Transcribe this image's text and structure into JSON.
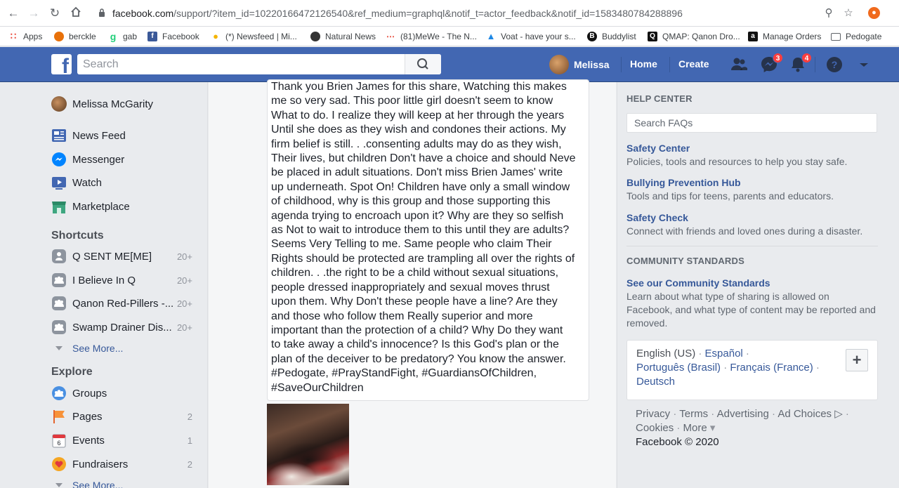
{
  "browser": {
    "url_host": "facebook.com",
    "url_rest": "/support/?item_id=10220166472126540&ref_medium=graphql&notif_t=actor_feedback&notif_id=1583480784288896",
    "bookmarks": [
      {
        "label": "Apps",
        "icon": "apps-grid-icon",
        "color": "#ea4335"
      },
      {
        "label": "berckle",
        "icon": "berckle-icon",
        "color": "#e8710a"
      },
      {
        "label": "gab",
        "icon": "gab-icon",
        "color": "#21cf7a"
      },
      {
        "label": "Facebook",
        "icon": "facebook-icon",
        "color": "#3b5998"
      },
      {
        "label": "(*) Newsfeed | Mi...",
        "icon": "lightbulb-icon",
        "color": "#f4b400"
      },
      {
        "label": "Natural News",
        "icon": "natural-news-icon",
        "color": "#333333"
      },
      {
        "label": "(81)MeWe - The N...",
        "icon": "mewe-icon",
        "color": "#e74c3c"
      },
      {
        "label": "Voat - have your s...",
        "icon": "voat-icon",
        "color": "#1e88e5"
      },
      {
        "label": "Buddylist",
        "icon": "buddylist-icon",
        "color": "#111111"
      },
      {
        "label": "QMAP: Qanon Dro...",
        "icon": "qmap-icon",
        "color": "#111111"
      },
      {
        "label": "Manage Orders",
        "icon": "amazon-icon",
        "color": "#111111"
      },
      {
        "label": "Pedogate",
        "icon": "folder-icon",
        "color": "#5f6368"
      }
    ]
  },
  "topbar": {
    "search_placeholder": "Search",
    "user_name": "Melissa",
    "home": "Home",
    "create": "Create",
    "messages_badge": "3",
    "notifications_badge": "4"
  },
  "sidebar": {
    "profile_name": "Melissa McGarity",
    "main_items": [
      {
        "label": "News Feed",
        "icon": "news-feed-icon"
      },
      {
        "label": "Messenger",
        "icon": "messenger-icon"
      },
      {
        "label": "Watch",
        "icon": "watch-icon"
      },
      {
        "label": "Marketplace",
        "icon": "marketplace-icon"
      }
    ],
    "shortcuts_title": "Shortcuts",
    "shortcuts": [
      {
        "label": "Q SENT ME[ME]",
        "count": "20+"
      },
      {
        "label": "I Believe In Q",
        "count": "20+"
      },
      {
        "label": "Qanon Red-Pillers -...",
        "count": "20+"
      },
      {
        "label": "Swamp Drainer Dis...",
        "count": "20+"
      }
    ],
    "see_more": "See More...",
    "explore_title": "Explore",
    "explore": [
      {
        "label": "Groups",
        "count": ""
      },
      {
        "label": "Pages",
        "count": "2"
      },
      {
        "label": "Events",
        "count": "1"
      },
      {
        "label": "Fundraisers",
        "count": "2"
      }
    ],
    "see_more_2": "See More..."
  },
  "main": {
    "comment": "Thank you Brien James for this share, Watching this makes\nme so very sad. This poor little girl doesn't seem to know\nWhat to do. I realize they will keep at her through the years\nUntil she does as they wish and condones their actions. My\nfirm belief is still. . .consenting adults may do as they wish,\nTheir lives, but children Don't have a choice and should Neve\nbe placed in adult situations. Don't miss Brien James' write\nup underneath. Spot On! Children have only a small window\nof childhood, why is this group and those supporting this\nagenda trying to encroach upon it? Why are they so selfish\nas Not to wait to introduce them to this until they are adults?\nSeems Very Telling to me. Same people who claim Their\nRights should be protected are trampling all over the rights of\nchildren. . .the right to be a child without sexual situations,\npeople dressed inappropriately and sexual moves thrust\nupon them. Why Don't these people have a line? Are they\nand those who follow them Really superior and more\nimportant than the protection of a child? Why Do they want\nto take away a child's innocence? Is this God's plan or the\nplan of the deceiver to be predatory? You know the answer.\n#Pedogate, #PrayStandFight, #GuardiansOfChildren,\n#SaveOurChildren"
  },
  "help": {
    "title": "HELP CENTER",
    "search_placeholder": "Search FAQs",
    "links": [
      {
        "title": "Safety Center",
        "desc": "Policies, tools and resources to help you stay safe."
      },
      {
        "title": "Bullying Prevention Hub",
        "desc": "Tools and tips for teens, parents and educators."
      },
      {
        "title": "Safety Check",
        "desc": "Connect with friends and loved ones during a disaster."
      }
    ],
    "community_title": "COMMUNITY STANDARDS",
    "community_link": "See our Community Standards",
    "community_desc": "Learn about what type of sharing is allowed on Facebook, and what type of content may be reported and removed."
  },
  "languages": {
    "current": "English (US)",
    "options": [
      "Español",
      "Português (Brasil)",
      "Français (France)",
      "Deutsch"
    ]
  },
  "footer": {
    "links": [
      "Privacy",
      "Terms",
      "Advertising",
      "Ad Choices",
      "Cookies",
      "More"
    ],
    "copyright": "Facebook © 2020"
  }
}
